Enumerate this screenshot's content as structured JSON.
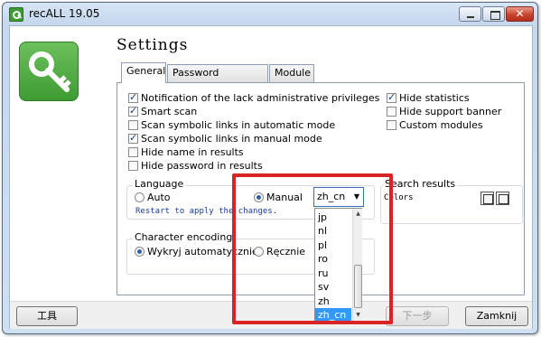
{
  "window": {
    "title": "recALL 19.05"
  },
  "heading": "Settings",
  "tabs": [
    {
      "label": "General",
      "active": true
    },
    {
      "label": "Password recovery",
      "active": false
    },
    {
      "label": "Module",
      "active": false
    }
  ],
  "options_left": [
    {
      "label": "Notification of the lack administrative privileges",
      "checked": true
    },
    {
      "label": "Smart scan",
      "checked": true
    },
    {
      "label": "Scan symbolic links in automatic mode",
      "checked": false
    },
    {
      "label": "Scan symbolic links in manual mode",
      "checked": true
    },
    {
      "label": "Hide name in results",
      "checked": false
    },
    {
      "label": "Hide password in results",
      "checked": false
    }
  ],
  "options_right": [
    {
      "label": "Hide statistics",
      "checked": true
    },
    {
      "label": "Hide support banner",
      "checked": false
    },
    {
      "label": "Custom modules",
      "checked": false
    }
  ],
  "language": {
    "group_label": "Language",
    "auto_label": "Auto",
    "manual_label": "Manual",
    "selected_mode": "Manual",
    "selected_value": "zh_cn",
    "restart_note": "Restart to apply the changes.",
    "options": [
      "jp",
      "nl",
      "pl",
      "ro",
      "ru",
      "sv",
      "zh",
      "zh_cn"
    ]
  },
  "search_results": {
    "group_label": "Search results",
    "colors_label": "Colors"
  },
  "encoding": {
    "group_label": "Character encoding",
    "auto_label": "Wykryj automatycznie",
    "manual_label": "Ręcznie",
    "selected": "auto"
  },
  "buttons": {
    "tools": "工具",
    "next": "下一步",
    "close": "Zamknij"
  },
  "colors": {
    "highlight": "#d82424",
    "selection": "#3399ff",
    "accent": "#3a9a2f"
  }
}
